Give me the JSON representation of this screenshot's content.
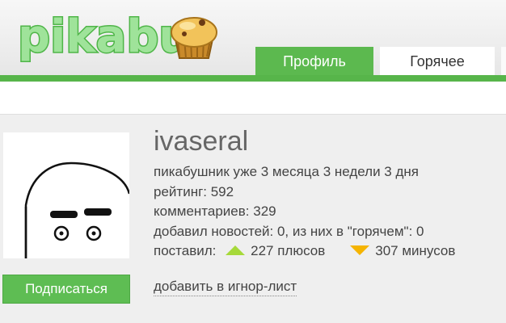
{
  "header": {
    "logo_text": "pikabu",
    "tabs": [
      {
        "label": "Профиль",
        "active": true
      },
      {
        "label": "Горячее",
        "active": false
      }
    ]
  },
  "profile": {
    "username": "ivaseral",
    "subscribe_label": "Подписаться",
    "ignore_label": "добавить в игнор-лист",
    "stats": {
      "tenure": "пикабушник уже 3 месяца 3 недели 3 дня",
      "rating": "рейтинг: 592",
      "comments": "комментариев: 329",
      "news": "добавил новостей: 0, из них в \"горячем\": 0",
      "votes_prefix": "поставил:",
      "plus": "227 плюсов",
      "minus": "307 минусов"
    }
  },
  "colors": {
    "brand_green": "#5cb94f",
    "up_arrow": "#a6d93a",
    "down_arrow": "#f5b400"
  },
  "icons": {
    "avatar": "default-face-avatar",
    "upvote": "triangle-up-icon",
    "downvote": "triangle-down-icon"
  }
}
